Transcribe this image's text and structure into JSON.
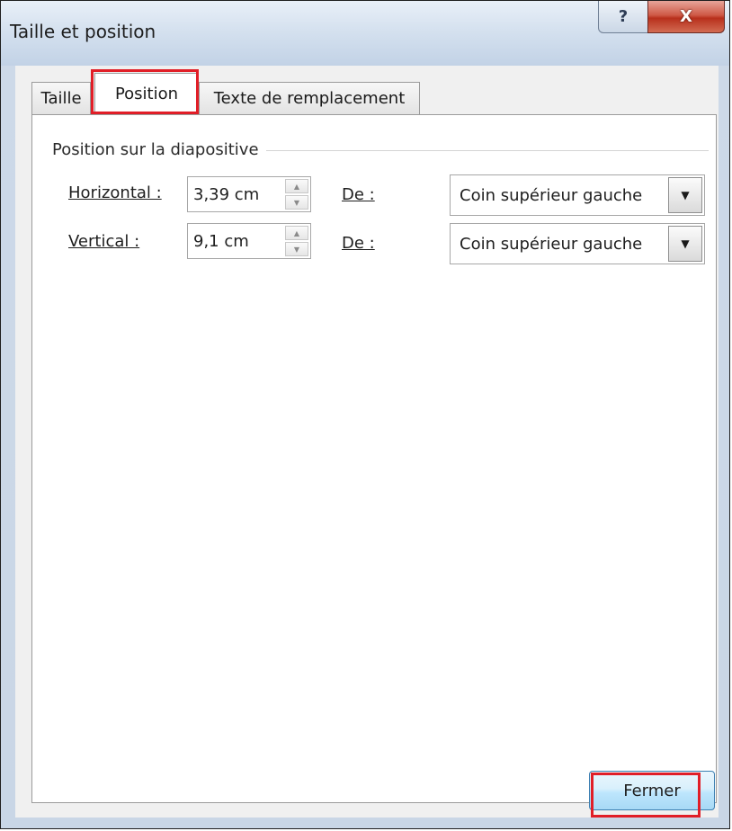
{
  "window": {
    "title": "Taille et position",
    "help_glyph": "?",
    "close_glyph": "X"
  },
  "tabs": [
    {
      "label": "Taille",
      "selected": false
    },
    {
      "label": "Position",
      "selected": true
    },
    {
      "label": "Texte de remplacement",
      "selected": false
    }
  ],
  "group": {
    "label": "Position sur la diapositive"
  },
  "horizontal": {
    "label": "Horizontal :",
    "value": "3,39 cm",
    "from_label": "De :",
    "from_value": "Coin supérieur gauche"
  },
  "vertical": {
    "label": "Vertical :",
    "value": "9,1 cm",
    "from_label": "De :",
    "from_value": "Coin supérieur gauche"
  },
  "footer": {
    "close_label": "Fermer"
  },
  "colors": {
    "highlight": "#e11e27",
    "accent_button": "#3c7fb1"
  },
  "icons": {
    "spin_up": "▲",
    "spin_down": "▼",
    "dropdown": "▼"
  }
}
